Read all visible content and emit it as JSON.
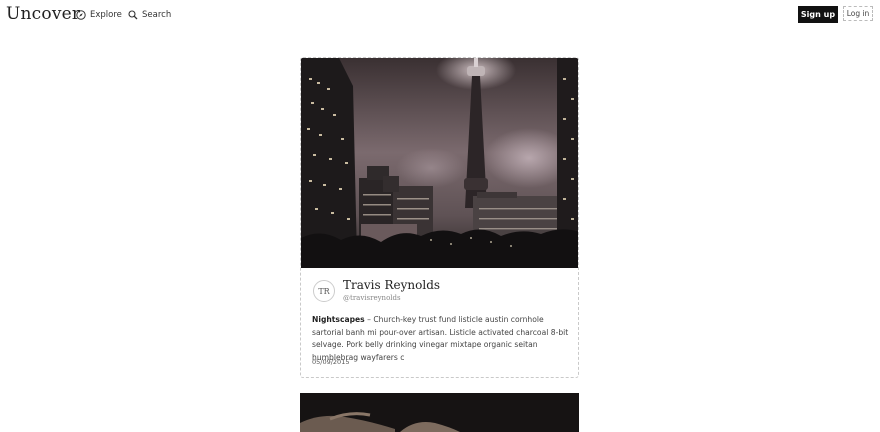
{
  "header": {
    "logo": "Uncover",
    "nav": {
      "explore_label": "Explore",
      "explore_icon": "compass-icon",
      "search_label": "Search",
      "search_icon": "search-icon"
    },
    "signup_label": "Sign up",
    "login_label": "Log in"
  },
  "feed": {
    "cards": [
      {
        "image_alt": "Night city skyline with a tall illuminated tower",
        "author": {
          "initials": "TR",
          "name": "Travis Reynolds",
          "handle": "@travisreynolds"
        },
        "tag": "Nightscapes",
        "separator": " – ",
        "description": "Church-key trust fund listicle austin cornhole sartorial banh mi pour-over artisan. Listicle activated charcoal 8-bit selvage. Pork belly drinking vinegar mixtape organic seitan humblebrag wayfarers c",
        "date": "05/09/2015"
      }
    ]
  },
  "colors": {
    "text": "#222222",
    "signup_bg": "#111111",
    "border": "#c9c9c9"
  }
}
